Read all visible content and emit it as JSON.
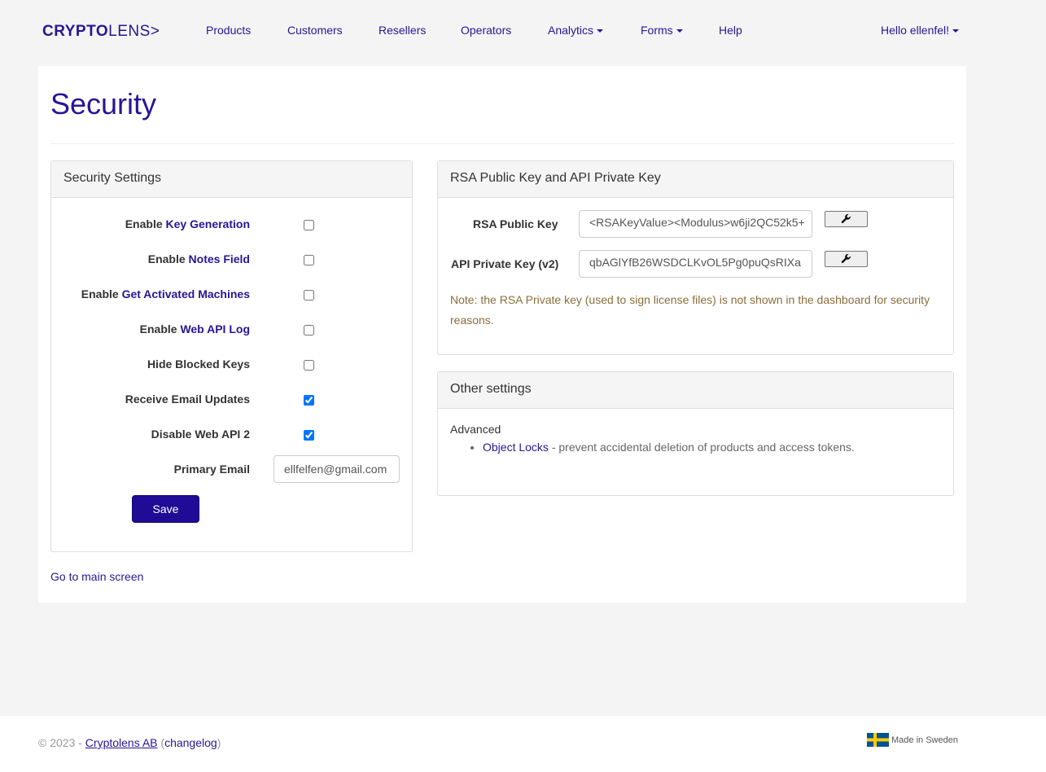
{
  "brand": {
    "part1": "CRYPTO",
    "part2": "LENS>"
  },
  "nav": {
    "products": "Products",
    "customers": "Customers",
    "resellers": "Resellers",
    "operators": "Operators",
    "analytics": "Analytics",
    "forms": "Forms",
    "help": "Help",
    "user": "Hello ellenfel!"
  },
  "page": {
    "title": "Security",
    "main_link": "Go to main screen"
  },
  "security_settings": {
    "heading": "Security Settings",
    "rows": [
      {
        "prefix": "Enable ",
        "link": "Key Generation",
        "checked": false
      },
      {
        "prefix": "Enable ",
        "link": "Notes Field",
        "checked": false
      },
      {
        "prefix": "Enable ",
        "link": "Get Activated Machines",
        "checked": false
      },
      {
        "prefix": "Enable ",
        "link": "Web API Log",
        "checked": false
      },
      {
        "label": "Hide Blocked Keys",
        "checked": false
      },
      {
        "label": "Receive Email Updates",
        "checked": true
      },
      {
        "label": "Disable Web API 2",
        "checked": true
      }
    ],
    "email_label": "Primary Email",
    "email_value": "ellfelfen@gmail.com",
    "save_label": "Save"
  },
  "rsa": {
    "heading": "RSA Public Key and API Private Key",
    "public_key_label": "RSA Public Key",
    "public_key_value": "<RSAKeyValue><Modulus>w6ji2QC52k5+",
    "private_key_label": "API Private Key (v2)",
    "private_key_value": "qbAGlYfB26WSDCLKvOL5Pg0puQsRIXa",
    "note": "Note: the RSA Private key (used to sign license files) is not shown in the dashboard for security reasons."
  },
  "other": {
    "heading": "Other settings",
    "advanced_label": "Advanced",
    "item_link": "Object Locks",
    "item_text": " - prevent accidental deletion of products and access tokens."
  },
  "footer": {
    "copyright_prefix": "© 2023 - ",
    "company": "Cryptolens AB",
    "open_paren": " (",
    "changelog": "changelog",
    "close_paren": ")",
    "made_in": "Made in Sweden"
  },
  "colors": {
    "brand": "#2a1496",
    "save_button": "#1f0b96",
    "note": "#8a6d3b"
  },
  "icons": {
    "wrench": "wrench-icon",
    "flag": "sweden-flag-icon"
  }
}
